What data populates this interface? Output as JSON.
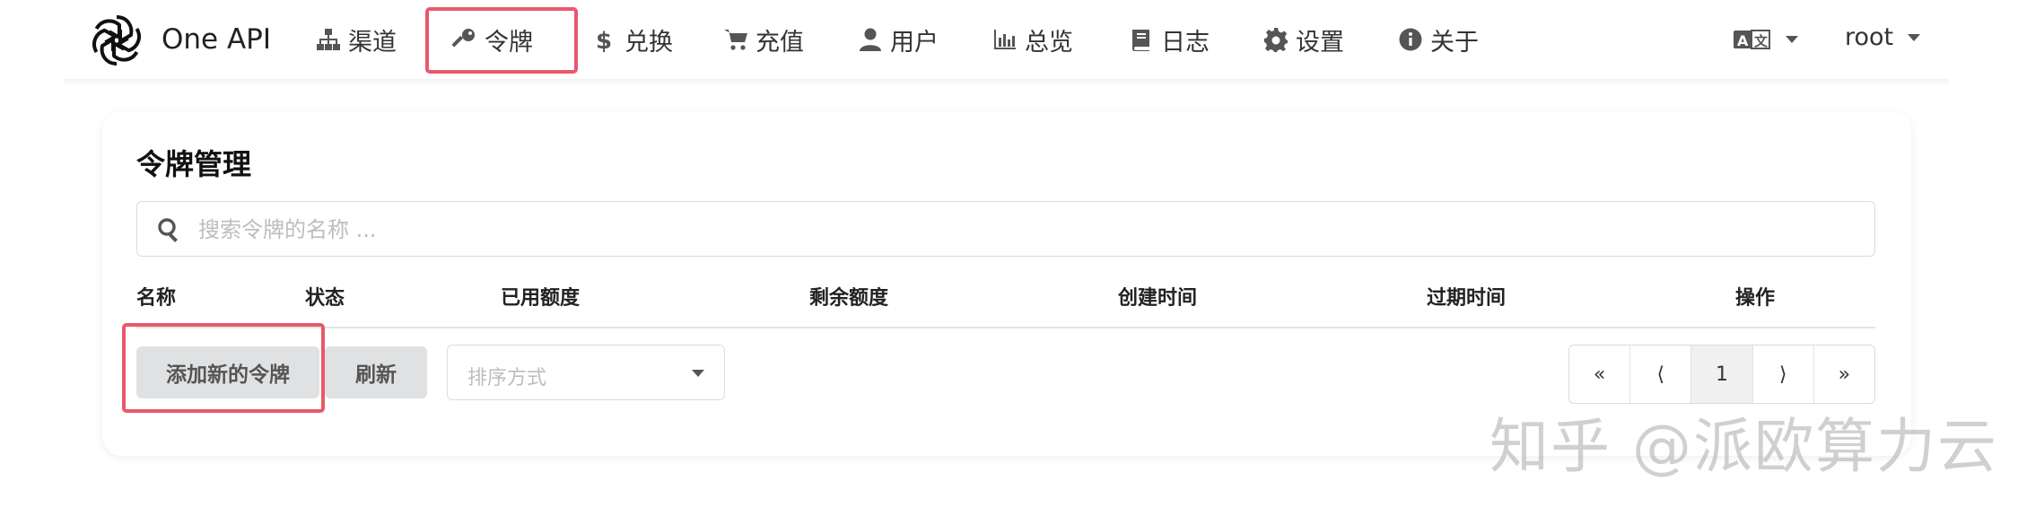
{
  "navbar": {
    "brand": "One API",
    "items": [
      {
        "label": "渠道",
        "icon": "sitemap-icon"
      },
      {
        "label": "令牌",
        "icon": "key-icon"
      },
      {
        "label": "兑换",
        "icon": "dollar-icon"
      },
      {
        "label": "充值",
        "icon": "cart-icon"
      },
      {
        "label": "用户",
        "icon": "user-icon"
      },
      {
        "label": "总览",
        "icon": "bar-chart-icon"
      },
      {
        "label": "日志",
        "icon": "book-icon"
      },
      {
        "label": "设置",
        "icon": "gear-icon"
      },
      {
        "label": "关于",
        "icon": "info-icon"
      }
    ],
    "language_icon": "translate-icon",
    "user": "root"
  },
  "page": {
    "title": "令牌管理",
    "search_placeholder": "搜索令牌的名称 ..."
  },
  "table": {
    "columns": [
      "名称",
      "状态",
      "已用额度",
      "剩余额度",
      "创建时间",
      "过期时间",
      "操作"
    ]
  },
  "actions": {
    "add_label": "添加新的令牌",
    "refresh_label": "刷新",
    "sort_placeholder": "排序方式"
  },
  "pagination": {
    "first": "«",
    "prev": "⟨",
    "current": "1",
    "next": "⟩",
    "last": "»"
  },
  "watermark": "知乎 @派欧算力云",
  "colors": {
    "highlight": "#e8596b",
    "button_bg": "#e0e1e2"
  }
}
